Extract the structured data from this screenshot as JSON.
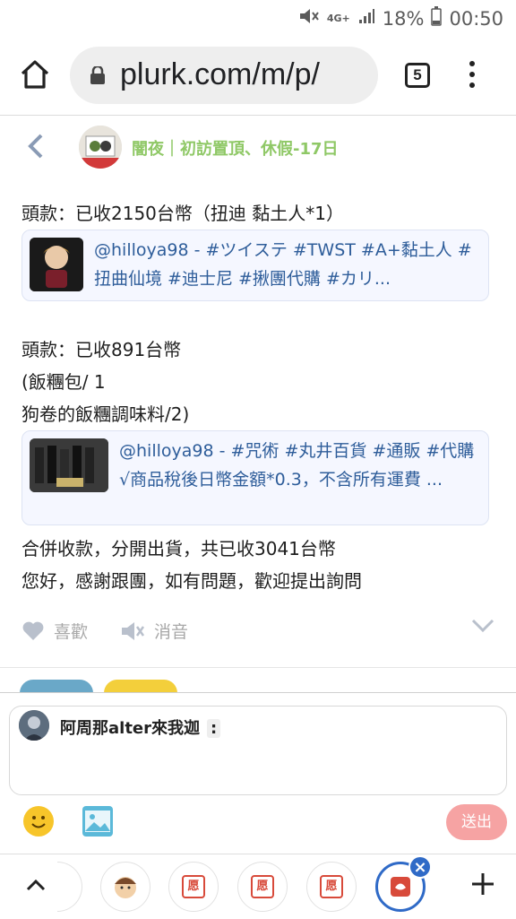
{
  "status": {
    "battery": "18%",
    "time": "00:50",
    "network": "4G+"
  },
  "browser": {
    "url": "plurk.com/m/p/",
    "tab_count": "5"
  },
  "post": {
    "title": "闇夜｜初訪置頂、休假-17日",
    "line1": "頭款：已收2150台幣（扭迪 黏土人*1）",
    "card1": {
      "text": "@hilloya98 - #ツイステ #TWST #A+黏土人 # 扭曲仙境 #迪士尼 #揪團代購 #カリ..."
    },
    "line2": "頭款：已收891台幣",
    "line3": "(飯糰包/ 1",
    "line4": "狗卷的飯糰調味料/2)",
    "card2": {
      "text": "@hilloya98 - #咒術 #丸井百貨 #通販 #代購 √商品稅後日幣金額*0.3，不含所有運費 ..."
    },
    "line5": "合併收款，分開出貨，共已收3041台幣",
    "line6": "您好，感謝跟團，如有問題，歡迎提出詢問"
  },
  "actions": {
    "like": "喜歡",
    "mute": "消音"
  },
  "reply": {
    "name": "阿周那alter來我迦",
    "qualifier": ":",
    "send": "送出"
  },
  "bottom_bar": {
    "stamp_label": "愿"
  },
  "colors": {
    "accent_green": "#8fc866",
    "link_blue": "#2e5d9a",
    "send_pink": "#f6a3a3",
    "active_blue": "#2f6ac7"
  }
}
